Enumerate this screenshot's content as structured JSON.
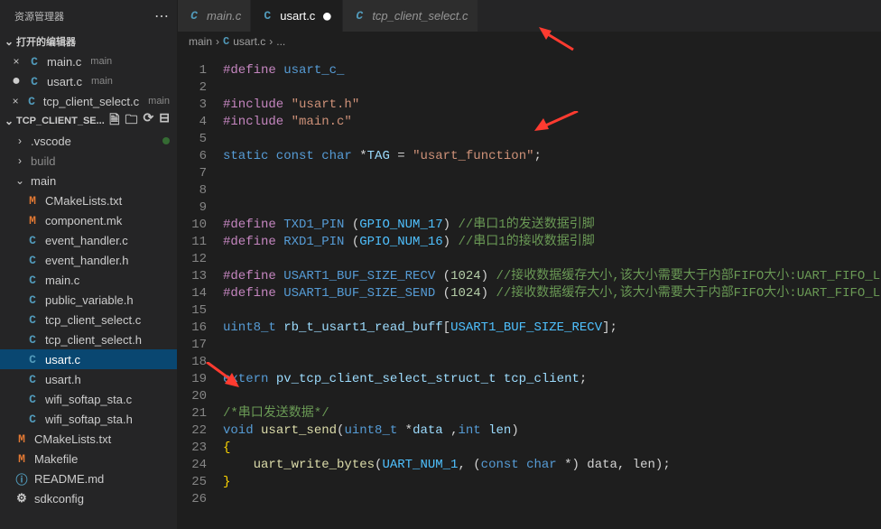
{
  "sidebar": {
    "title": "资源管理器",
    "openEditorsLabel": "打开的编辑器",
    "openEditors": [
      {
        "icon": "C",
        "iconClass": "ico-c",
        "name": "main.c",
        "dir": "main",
        "dirty": false
      },
      {
        "icon": "C",
        "iconClass": "ico-c",
        "name": "usart.c",
        "dir": "main",
        "dirty": true,
        "active": true
      },
      {
        "icon": "C",
        "iconClass": "ico-c",
        "name": "tcp_client_select.c",
        "dir": "main",
        "dirty": false
      }
    ],
    "project": {
      "name": "TCP_CLIENT_SE..."
    },
    "tree": [
      {
        "kind": "folder",
        "open": false,
        "name": ".vscode",
        "mod": true,
        "indent": 1
      },
      {
        "kind": "folder",
        "open": false,
        "name": "build",
        "gray": true,
        "indent": 1
      },
      {
        "kind": "folder",
        "open": true,
        "name": "main",
        "indent": 1
      },
      {
        "kind": "file",
        "icon": "M",
        "iconClass": "ico-m",
        "name": "CMakeLists.txt",
        "indent": 2
      },
      {
        "kind": "file",
        "icon": "M",
        "iconClass": "ico-m",
        "name": "component.mk",
        "indent": 2
      },
      {
        "kind": "file",
        "icon": "C",
        "iconClass": "ico-c",
        "name": "event_handler.c",
        "indent": 2
      },
      {
        "kind": "file",
        "icon": "C",
        "iconClass": "ico-c",
        "name": "event_handler.h",
        "indent": 2
      },
      {
        "kind": "file",
        "icon": "C",
        "iconClass": "ico-c",
        "name": "main.c",
        "indent": 2
      },
      {
        "kind": "file",
        "icon": "C",
        "iconClass": "ico-c",
        "name": "public_variable.h",
        "indent": 2
      },
      {
        "kind": "file",
        "icon": "C",
        "iconClass": "ico-c",
        "name": "tcp_client_select.c",
        "indent": 2
      },
      {
        "kind": "file",
        "icon": "C",
        "iconClass": "ico-c",
        "name": "tcp_client_select.h",
        "indent": 2
      },
      {
        "kind": "file",
        "icon": "C",
        "iconClass": "ico-c",
        "name": "usart.c",
        "indent": 2,
        "selected": true
      },
      {
        "kind": "file",
        "icon": "C",
        "iconClass": "ico-c",
        "name": "usart.h",
        "indent": 2
      },
      {
        "kind": "file",
        "icon": "C",
        "iconClass": "ico-c",
        "name": "wifi_softap_sta.c",
        "indent": 2
      },
      {
        "kind": "file",
        "icon": "C",
        "iconClass": "ico-c",
        "name": "wifi_softap_sta.h",
        "indent": 2
      },
      {
        "kind": "file",
        "icon": "M",
        "iconClass": "ico-m",
        "name": "CMakeLists.txt",
        "indent": 1
      },
      {
        "kind": "file",
        "icon": "M",
        "iconClass": "ico-mk",
        "name": "Makefile",
        "indent": 1
      },
      {
        "kind": "file",
        "icon": "ⓘ",
        "iconClass": "ico-info",
        "name": "README.md",
        "indent": 1
      },
      {
        "kind": "file",
        "icon": "⚙",
        "iconClass": "ico-gear",
        "name": "sdkconfig",
        "indent": 1
      }
    ]
  },
  "tabs": [
    {
      "icon": "C",
      "name": "main.c",
      "active": false,
      "dirty": false,
      "italic": true
    },
    {
      "icon": "C",
      "name": "usart.c",
      "active": true,
      "dirty": true,
      "italic": false
    },
    {
      "icon": "C",
      "name": "tcp_client_select.c",
      "active": false,
      "dirty": false,
      "italic": true
    }
  ],
  "breadcrumb": {
    "parts": [
      "main",
      "usart.c",
      "..."
    ]
  },
  "code": {
    "lineStart": 1,
    "lines": [
      [
        [
          "purple",
          "#define"
        ],
        [
          "plain",
          " "
        ],
        [
          "macro",
          "usart_c_"
        ]
      ],
      [],
      [
        [
          "purple",
          "#include"
        ],
        [
          "plain",
          " "
        ],
        [
          "string",
          "\"usart.h\""
        ]
      ],
      [
        [
          "purple",
          "#include"
        ],
        [
          "plain",
          " "
        ],
        [
          "string",
          "\"main.c\""
        ]
      ],
      [],
      [
        [
          "type",
          "static const char "
        ],
        [
          "plain",
          "*"
        ],
        [
          "id",
          "TAG"
        ],
        [
          "plain",
          " = "
        ],
        [
          "string",
          "\"usart_function\""
        ],
        [
          "plain",
          ";"
        ]
      ],
      [],
      [],
      [],
      [
        [
          "purple",
          "#define"
        ],
        [
          "plain",
          " "
        ],
        [
          "macro",
          "TXD1_PIN"
        ],
        [
          "plain",
          " "
        ],
        [
          "paren",
          "("
        ],
        [
          "const",
          "GPIO_NUM_17"
        ],
        [
          "paren",
          ")"
        ],
        [
          "plain",
          " "
        ],
        [
          "comment",
          "//串口1的发送数据引脚"
        ]
      ],
      [
        [
          "purple",
          "#define"
        ],
        [
          "plain",
          " "
        ],
        [
          "macro",
          "RXD1_PIN"
        ],
        [
          "plain",
          " "
        ],
        [
          "paren",
          "("
        ],
        [
          "const",
          "GPIO_NUM_16"
        ],
        [
          "paren",
          ")"
        ],
        [
          "plain",
          " "
        ],
        [
          "comment",
          "//串口1的接收数据引脚"
        ]
      ],
      [],
      [
        [
          "purple",
          "#define"
        ],
        [
          "plain",
          " "
        ],
        [
          "macro",
          "USART1_BUF_SIZE_RECV"
        ],
        [
          "plain",
          " "
        ],
        [
          "paren",
          "("
        ],
        [
          "num",
          "1024"
        ],
        [
          "paren",
          ")"
        ],
        [
          "plain",
          " "
        ],
        [
          "comment",
          "//接收数据缓存大小,该大小需要大于内部FIFO大小:UART_FIFO_LEN"
        ]
      ],
      [
        [
          "purple",
          "#define"
        ],
        [
          "plain",
          " "
        ],
        [
          "macro",
          "USART1_BUF_SIZE_SEND"
        ],
        [
          "plain",
          " "
        ],
        [
          "paren",
          "("
        ],
        [
          "num",
          "1024"
        ],
        [
          "paren",
          ")"
        ],
        [
          "plain",
          " "
        ],
        [
          "comment",
          "//接收数据缓存大小,该大小需要大于内部FIFO大小:UART_FIFO_LEN"
        ]
      ],
      [],
      [
        [
          "type",
          "uint8_t"
        ],
        [
          "plain",
          " "
        ],
        [
          "id",
          "rb_t_usart1_read_buff"
        ],
        [
          "paren",
          "["
        ],
        [
          "const",
          "USART1_BUF_SIZE_RECV"
        ],
        [
          "paren",
          "]"
        ],
        [
          "plain",
          ";"
        ]
      ],
      [],
      [],
      [
        [
          "type",
          "extern"
        ],
        [
          "plain",
          " "
        ],
        [
          "id",
          "pv_tcp_client_select_struct_t"
        ],
        [
          "plain",
          " "
        ],
        [
          "id",
          "tcp_client"
        ],
        [
          "plain",
          ";"
        ]
      ],
      [],
      [
        [
          "comment",
          "/*串口发送数据*/"
        ]
      ],
      [
        [
          "type",
          "void"
        ],
        [
          "plain",
          " "
        ],
        [
          "func",
          "usart_send"
        ],
        [
          "paren",
          "("
        ],
        [
          "type",
          "uint8_t"
        ],
        [
          "plain",
          " *"
        ],
        [
          "id",
          "data"
        ],
        [
          "plain",
          " ,"
        ],
        [
          "type",
          "int"
        ],
        [
          "plain",
          " "
        ],
        [
          "id",
          "len"
        ],
        [
          "paren",
          ")"
        ]
      ],
      [
        [
          "bracket",
          "{"
        ]
      ],
      [
        [
          "plain",
          "    "
        ],
        [
          "func",
          "uart_write_bytes"
        ],
        [
          "paren",
          "("
        ],
        [
          "const",
          "UART_NUM_1"
        ],
        [
          "plain",
          ", "
        ],
        [
          "paren",
          "("
        ],
        [
          "type",
          "const char"
        ],
        [
          "plain",
          " *"
        ],
        [
          "paren",
          ")"
        ],
        [
          "plain",
          " data, len"
        ],
        [
          "paren",
          ")"
        ],
        [
          "plain",
          ";"
        ]
      ],
      [
        [
          "bracket",
          "}"
        ]
      ],
      []
    ]
  }
}
